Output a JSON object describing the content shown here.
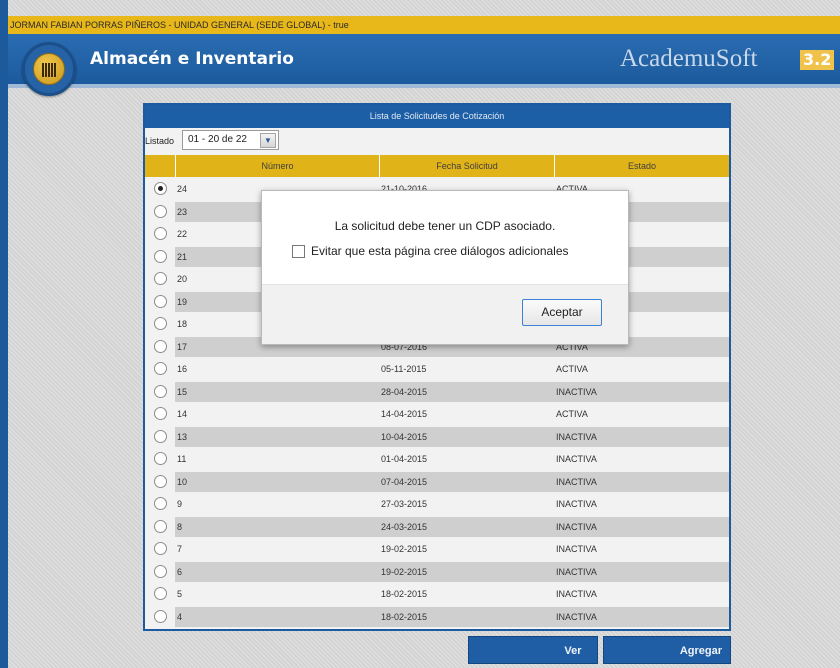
{
  "user_bar": {
    "text": "JORMAN FABIAN PORRAS PIÑEROS - UNIDAD GENERAL (SEDE GLOBAL) - true"
  },
  "header": {
    "app_title": "Almacén e Inventario",
    "brand_name": "AcademuSoft",
    "brand_version": "3.2",
    "logo_icon": "barcode-icon",
    "colors": {
      "band": "#1b5a9c",
      "user_bar": "#e8b719",
      "accent": "#e0b319"
    }
  },
  "list": {
    "title": "Lista de Solicitudes de Cotización",
    "listado_label": "Listado",
    "listado_value": "01 - 20 de 22",
    "columns": [
      "Número",
      "Fecha Solicitud",
      "Estado"
    ],
    "rows": [
      {
        "numero": "24",
        "fecha": "21-10-2016",
        "estado": "ACTIVA",
        "selected": true
      },
      {
        "numero": "23",
        "fecha": "",
        "estado": ""
      },
      {
        "numero": "22",
        "fecha": "",
        "estado": ""
      },
      {
        "numero": "21",
        "fecha": "",
        "estado": ""
      },
      {
        "numero": "20",
        "fecha": "",
        "estado": ""
      },
      {
        "numero": "19",
        "fecha": "",
        "estado": ""
      },
      {
        "numero": "18",
        "fecha": "",
        "estado": ""
      },
      {
        "numero": "17",
        "fecha": "08-07-2016",
        "estado": "ACTIVA"
      },
      {
        "numero": "16",
        "fecha": "05-11-2015",
        "estado": "ACTIVA"
      },
      {
        "numero": "15",
        "fecha": "28-04-2015",
        "estado": "INACTIVA"
      },
      {
        "numero": "14",
        "fecha": "14-04-2015",
        "estado": "ACTIVA"
      },
      {
        "numero": "13",
        "fecha": "10-04-2015",
        "estado": "INACTIVA"
      },
      {
        "numero": "11",
        "fecha": "01-04-2015",
        "estado": "INACTIVA"
      },
      {
        "numero": "10",
        "fecha": "07-04-2015",
        "estado": "INACTIVA"
      },
      {
        "numero": "9",
        "fecha": "27-03-2015",
        "estado": "INACTIVA"
      },
      {
        "numero": "8",
        "fecha": "24-03-2015",
        "estado": "INACTIVA"
      },
      {
        "numero": "7",
        "fecha": "19-02-2015",
        "estado": "INACTIVA"
      },
      {
        "numero": "6",
        "fecha": "19-02-2015",
        "estado": "INACTIVA"
      },
      {
        "numero": "5",
        "fecha": "18-02-2015",
        "estado": "INACTIVA"
      },
      {
        "numero": "4",
        "fecha": "18-02-2015",
        "estado": "INACTIVA"
      }
    ],
    "buttons": {
      "ver": "Ver",
      "agregar": "Agregar"
    }
  },
  "dialog": {
    "message": "La solicitud debe tener un CDP asociado.",
    "checkbox_label": "Evitar que esta página cree diálogos adicionales",
    "checkbox_checked": false,
    "ok_label": "Aceptar"
  }
}
